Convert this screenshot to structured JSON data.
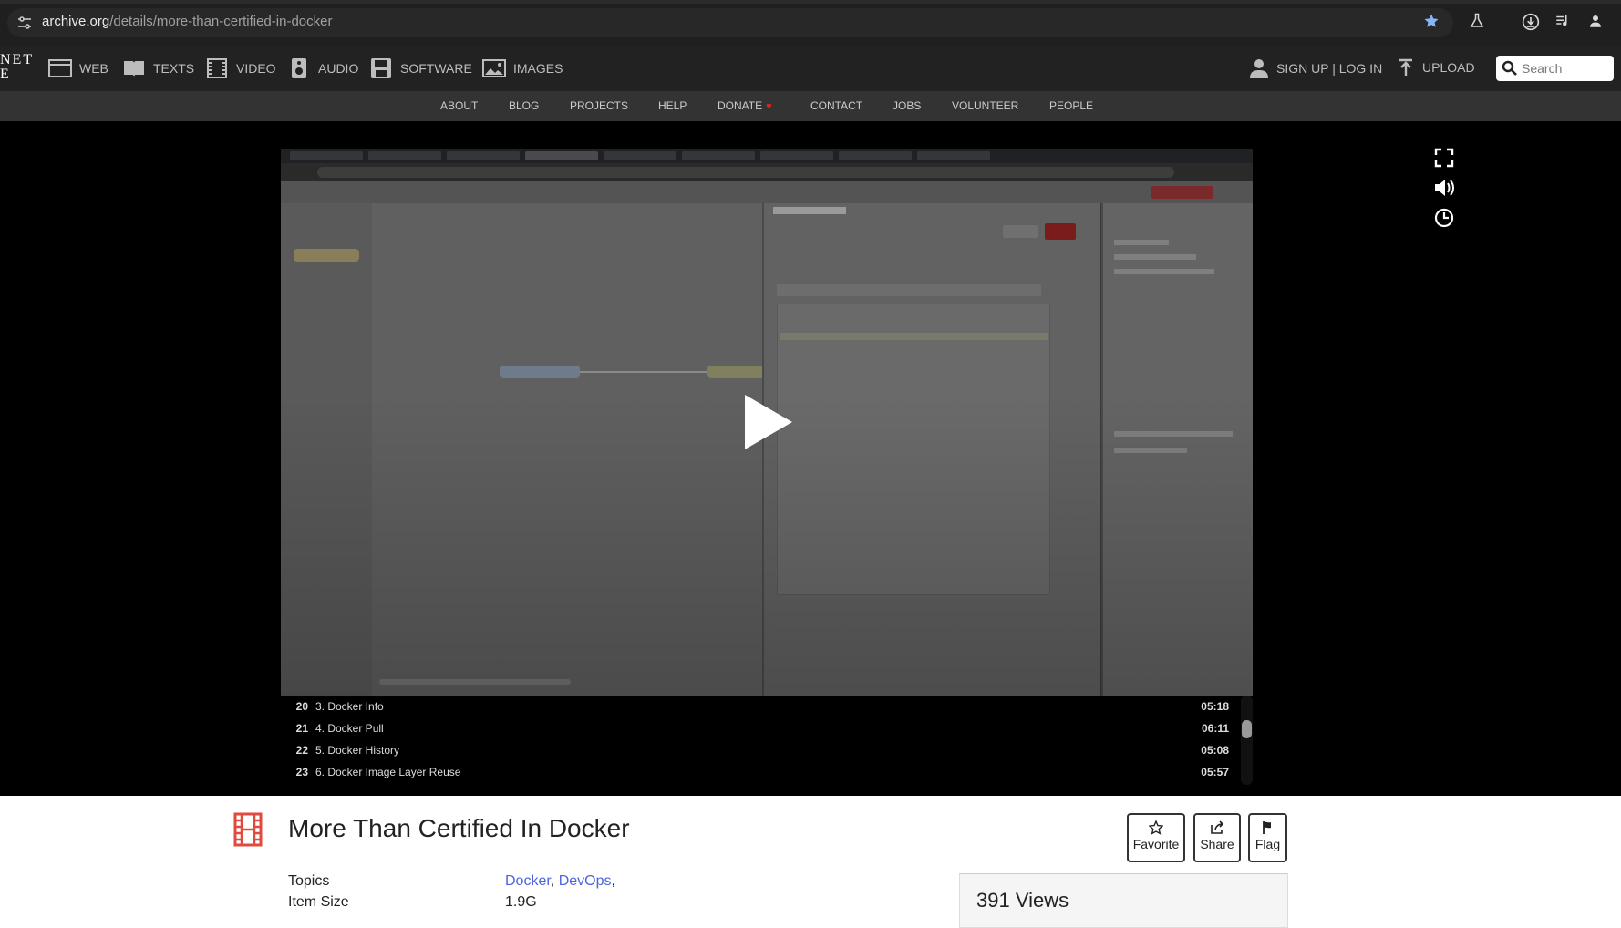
{
  "browser": {
    "url_host": "archive.org",
    "url_path": "/details/more-than-certified-in-docker"
  },
  "ia_nav": {
    "logo_line1": "NET",
    "logo_line2": "E",
    "media": [
      "WEB",
      "TEXTS",
      "VIDEO",
      "AUDIO",
      "SOFTWARE",
      "IMAGES"
    ],
    "auth": "SIGN UP | LOG IN",
    "upload": "UPLOAD",
    "search_placeholder": "Search"
  },
  "sub_nav": [
    "ABOUT",
    "BLOG",
    "PROJECTS",
    "HELP",
    "DONATE",
    "CONTACT",
    "JOBS",
    "VOLUNTEER",
    "PEOPLE"
  ],
  "playlist": [
    {
      "num": "20",
      "title": "3. Docker Info",
      "duration": "05:18"
    },
    {
      "num": "21",
      "title": "4. Docker Pull",
      "duration": "06:11"
    },
    {
      "num": "22",
      "title": "5. Docker History",
      "duration": "05:08"
    },
    {
      "num": "23",
      "title": "6. Docker Image Layer Reuse",
      "duration": "05:57"
    }
  ],
  "item": {
    "title": "More Than Certified In Docker",
    "actions": [
      "Favorite",
      "Share",
      "Flag"
    ],
    "topics_label": "Topics",
    "topics": [
      "Docker",
      "DevOps"
    ],
    "size_label": "Item Size",
    "size": "1.9G",
    "views": "391 Views"
  },
  "colors": {
    "accent_link": "#4b64de",
    "film_icon": "#e04a3f",
    "donate_heart": "#d9241b",
    "browser_star": "#8ab4f8"
  }
}
